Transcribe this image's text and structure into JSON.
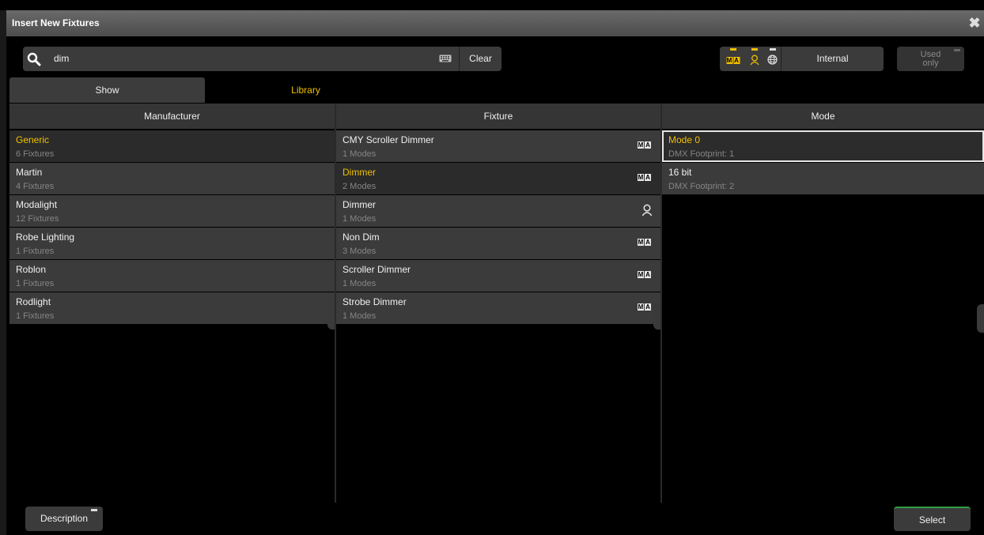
{
  "window": {
    "title": "Insert New Fixtures"
  },
  "search": {
    "value": "dim",
    "clear_label": "Clear"
  },
  "filters": {
    "internal_label": "Internal",
    "used_only_line1": "Used",
    "used_only_line2": "only",
    "ma_badge": [
      "M",
      "A"
    ]
  },
  "tabs": [
    {
      "label": "Show",
      "active": true
    },
    {
      "label": "Library",
      "active": false
    }
  ],
  "columns": {
    "manufacturer": {
      "header": "Manufacturer",
      "rows": [
        {
          "name": "Generic",
          "sub": "6 Fixtures",
          "selected": true
        },
        {
          "name": "Martin",
          "sub": "4 Fixtures"
        },
        {
          "name": "Modalight",
          "sub": "12 Fixtures"
        },
        {
          "name": "Robe Lighting",
          "sub": "1 Fixtures"
        },
        {
          "name": "Roblon",
          "sub": "1 Fixtures"
        },
        {
          "name": "Rodlight",
          "sub": "1 Fixtures"
        }
      ]
    },
    "fixture": {
      "header": "Fixture",
      "rows": [
        {
          "name": "CMY Scroller Dimmer",
          "sub": "1 Modes",
          "source": "ma"
        },
        {
          "name": "Dimmer",
          "sub": "2 Modes",
          "source": "ma",
          "selected": true
        },
        {
          "name": "Dimmer",
          "sub": "1 Modes",
          "source": "user"
        },
        {
          "name": "Non Dim",
          "sub": "3 Modes",
          "source": "ma"
        },
        {
          "name": "Scroller Dimmer",
          "sub": "1 Modes",
          "source": "ma"
        },
        {
          "name": "Strobe Dimmer",
          "sub": "1 Modes",
          "source": "ma"
        }
      ]
    },
    "mode": {
      "header": "Mode",
      "rows": [
        {
          "name": "Mode 0",
          "sub": "DMX Footprint: 1",
          "selected": true
        },
        {
          "name": "16 bit",
          "sub": "DMX Footprint: 2"
        }
      ]
    }
  },
  "bottom": {
    "description_label": "Description",
    "select_label": "Select"
  },
  "colors": {
    "accent": "#f0c000",
    "select_border": "#2f9e45",
    "background": "#000000"
  },
  "icons": [
    "close-icon",
    "search-icon",
    "keyboard-icon",
    "ma-icon",
    "user-icon",
    "globe-icon"
  ]
}
